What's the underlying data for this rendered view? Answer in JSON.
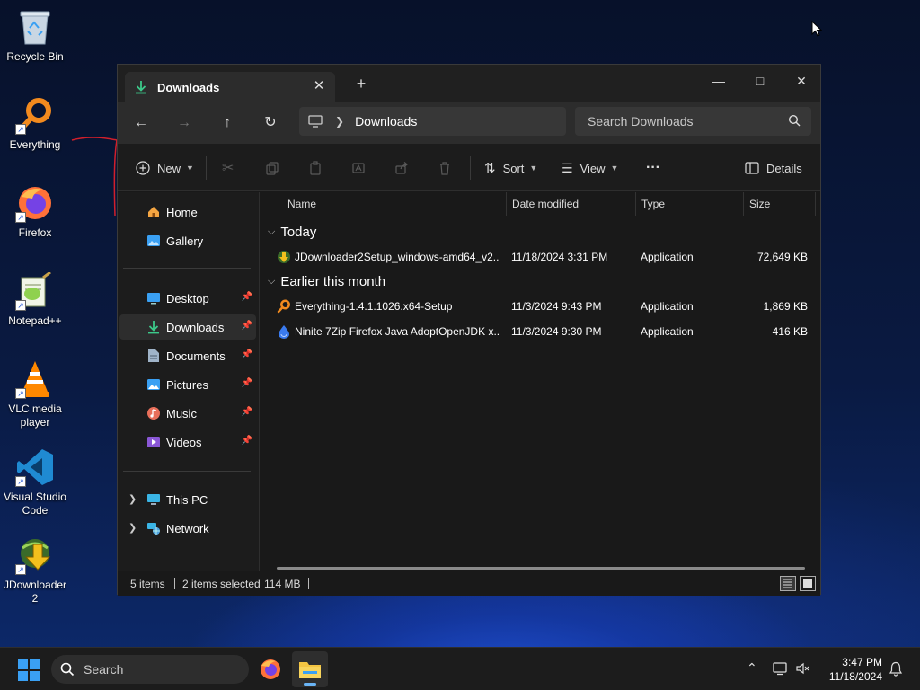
{
  "desktop": {
    "icons": [
      {
        "label": "Recycle Bin"
      },
      {
        "label": "Everything"
      },
      {
        "label": "Firefox"
      },
      {
        "label": "Notepad++"
      },
      {
        "label": "VLC media player"
      },
      {
        "label": "Visual Studio Code"
      },
      {
        "label": "JDownloader 2"
      }
    ]
  },
  "window": {
    "tab": {
      "title": "Downloads"
    },
    "nav": {
      "breadcrumb": [
        "Downloads"
      ],
      "search_placeholder": "Search Downloads"
    },
    "toolbar": {
      "new_label": "New",
      "sort_label": "Sort",
      "view_label": "View",
      "more_label": "···",
      "details_label": "Details"
    },
    "sidebar": {
      "items": [
        {
          "label": "Home"
        },
        {
          "label": "Gallery"
        },
        {
          "label": "Desktop"
        },
        {
          "label": "Downloads"
        },
        {
          "label": "Documents"
        },
        {
          "label": "Pictures"
        },
        {
          "label": "Music"
        },
        {
          "label": "Videos"
        },
        {
          "label": "This PC"
        },
        {
          "label": "Network"
        }
      ]
    },
    "columns": {
      "name": "Name",
      "date": "Date modified",
      "type": "Type",
      "size": "Size"
    },
    "groups": [
      {
        "label": "Today",
        "files": [
          {
            "name": "JDownloader2Setup_windows-amd64_v2...",
            "date": "11/18/2024 3:31 PM",
            "type": "Application",
            "size": "72,649 KB"
          }
        ]
      },
      {
        "label": "Earlier this month",
        "files": [
          {
            "name": "Everything-1.4.1.1026.x64-Setup",
            "date": "11/3/2024 9:43 PM",
            "type": "Application",
            "size": "1,869 KB"
          },
          {
            "name": "Ninite 7Zip Firefox Java AdoptOpenJDK x...",
            "date": "11/3/2024 9:30 PM",
            "type": "Application",
            "size": "416 KB"
          }
        ]
      }
    ],
    "status": {
      "items": "5 items",
      "selected": "2 items selected",
      "size": "114 MB"
    }
  },
  "taskbar": {
    "search_label": "Search",
    "time": "3:47 PM",
    "date": "11/18/2024"
  },
  "colors": {
    "accent": "#3aa0f3",
    "folder": "#f4c542",
    "download_green": "#3cc98a",
    "annotation_red": "#d21f2b"
  }
}
